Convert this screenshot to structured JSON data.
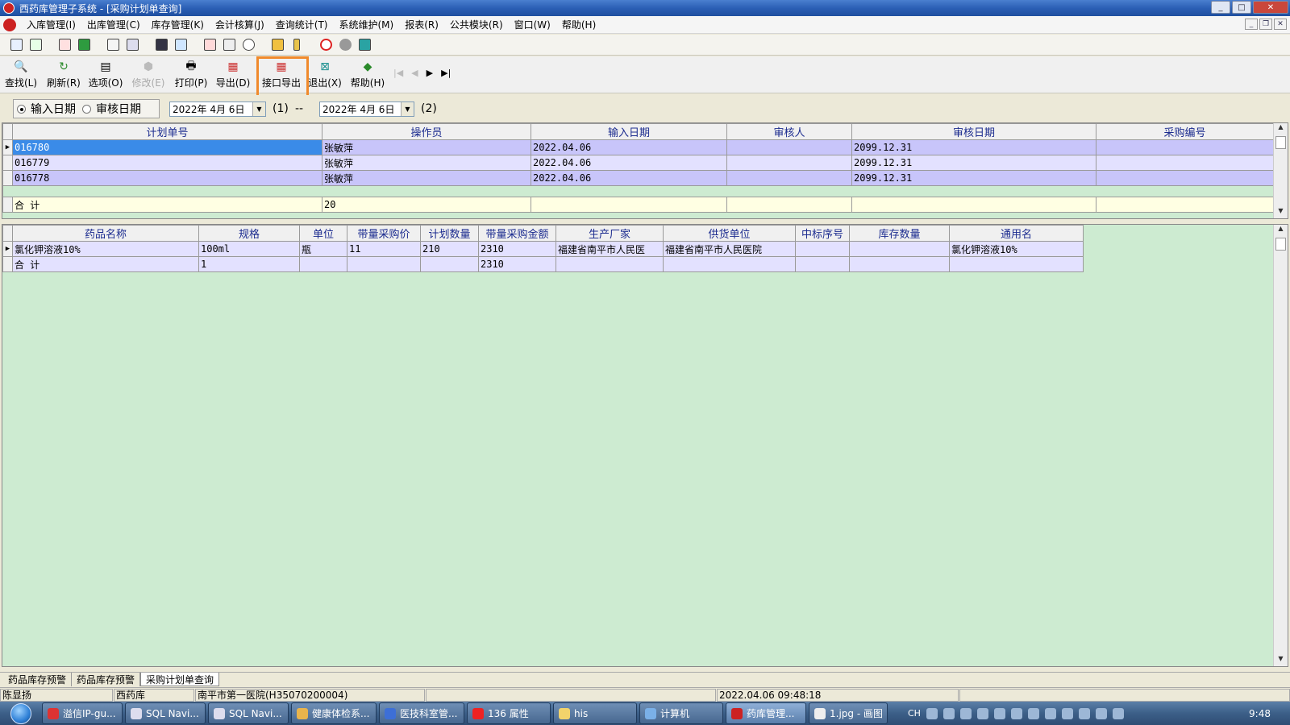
{
  "window": {
    "title": "西药库管理子系统 - [采购计划单查询]"
  },
  "menu": [
    "入库管理(I)",
    "出库管理(C)",
    "库存管理(K)",
    "会计核算(J)",
    "查询统计(T)",
    "系统维护(M)",
    "报表(R)",
    "公共模块(R)",
    "窗口(W)",
    "帮助(H)"
  ],
  "toolbar": {
    "buttons": [
      {
        "label": "查找(L)",
        "icon": "search-icon"
      },
      {
        "label": "刷新(R)",
        "icon": "refresh-icon"
      },
      {
        "label": "选项(O)",
        "icon": "options-icon"
      },
      {
        "label": "修改(E)",
        "icon": "edit-icon"
      },
      {
        "label": "打印(P)",
        "icon": "print-icon"
      },
      {
        "label": "导出(D)",
        "icon": "export-icon"
      },
      {
        "label": "接口导出",
        "icon": "interface-export-icon"
      },
      {
        "label": "退出(X)",
        "icon": "exit-icon"
      },
      {
        "label": "帮助(H)",
        "icon": "help-icon"
      }
    ]
  },
  "filter": {
    "radio1": "输入日期",
    "radio2": "审核日期",
    "date1": "2022年 4月 6日",
    "label1": "(1)",
    "dash": "--",
    "date2": "2022年 4月 6日",
    "label2": "(2)"
  },
  "plan_grid": {
    "headers": [
      "计划单号",
      "操作员",
      "输入日期",
      "审核人",
      "审核日期",
      "采购编号"
    ],
    "rows": [
      [
        "016780",
        "张敏萍",
        "2022.04.06",
        "",
        "2099.12.31",
        ""
      ],
      [
        "016779",
        "张敏萍",
        "2022.04.06",
        "",
        "2099.12.31",
        ""
      ],
      [
        "016778",
        "张敏萍",
        "2022.04.06",
        "",
        "2099.12.31",
        ""
      ]
    ],
    "total": [
      "合  计",
      "20",
      "",
      "",
      "",
      ""
    ]
  },
  "detail_grid": {
    "headers": [
      "药品名称",
      "规格",
      "单位",
      "带量采购价",
      "计划数量",
      "带量采购金额",
      "生产厂家",
      "供货单位",
      "中标序号",
      "库存数量",
      "通用名"
    ],
    "rows": [
      [
        "氯化钾溶液10%",
        "100ml",
        "瓶",
        "11",
        "210",
        "2310",
        "福建省南平市人民医",
        "福建省南平市人民医院",
        "",
        "",
        "氯化钾溶液10%"
      ]
    ],
    "total": [
      "合  计",
      "1",
      "",
      "",
      "",
      "2310",
      "",
      "",
      "",
      "",
      ""
    ]
  },
  "tabs": [
    "药品库存预警",
    "药品库存预警",
    "采购计划单查询"
  ],
  "status": {
    "user": "陈显扬",
    "dept": "西药库",
    "hospital": "南平市第一医院(H35070200004)",
    "datetime": "2022.04.06 09:48:18"
  },
  "taskbar": {
    "items": [
      "溢信IP-gu...",
      "SQL Navi...",
      "SQL Navi...",
      "健康体检系...",
      "医技科室管...",
      "136 属性",
      "his",
      "计算机",
      "药库管理...",
      "1.jpg - 画图"
    ],
    "lang": "CH",
    "clock": "9:48"
  }
}
